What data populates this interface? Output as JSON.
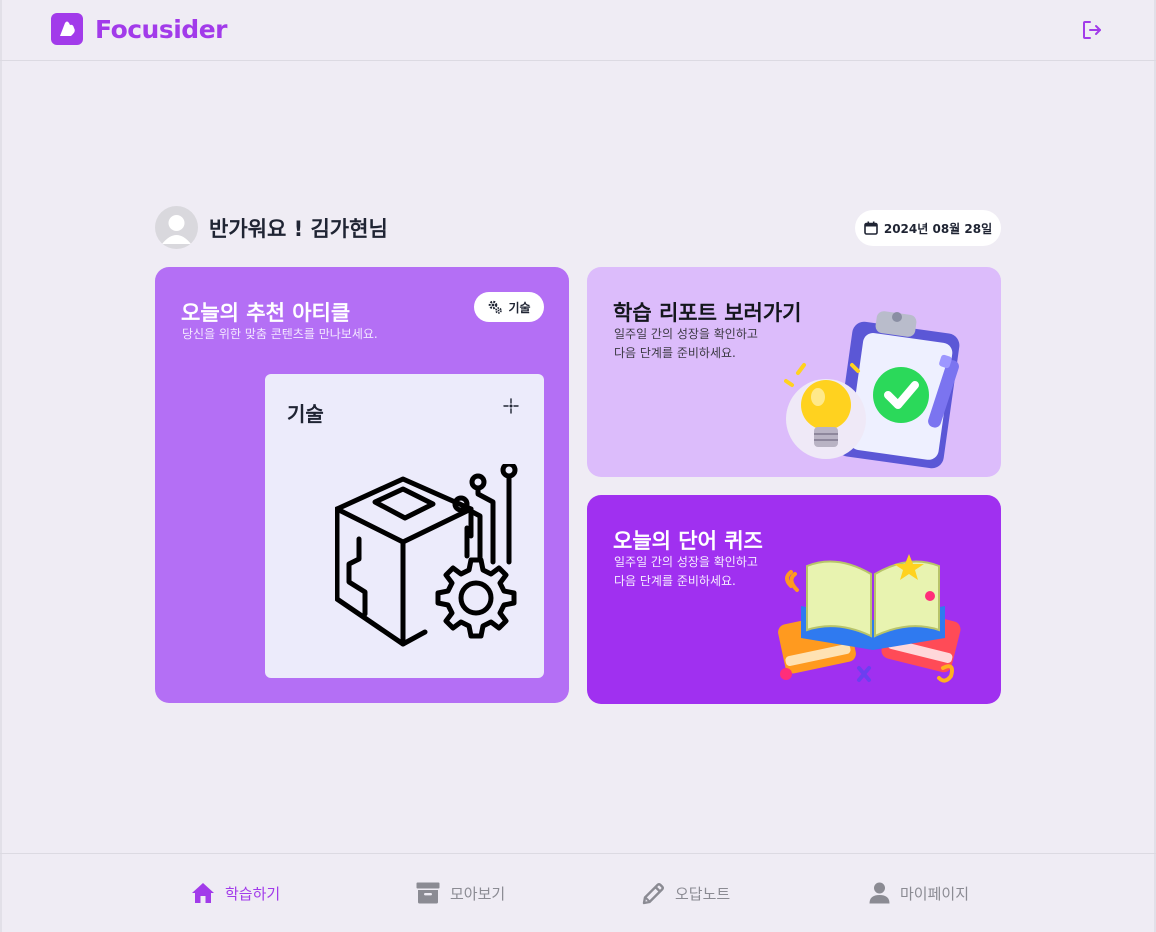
{
  "header": {
    "brand": "Focusider"
  },
  "greeting": {
    "text": "반가워요 ! 김가현님",
    "date": "2024년 08월 28일"
  },
  "article_card": {
    "title": "오늘의 추천 아티클",
    "subtitle": "당신을 위한 맞춤 콘텐츠를 만나보세요.",
    "tag": "기술",
    "inner_title": "기술"
  },
  "report_card": {
    "title": "학습 리포트 보러가기",
    "subtitle_line1": "일주일 간의 성장을 확인하고",
    "subtitle_line2": "다음 단계를 준비하세요."
  },
  "quiz_card": {
    "title": "오늘의 단어 퀴즈",
    "subtitle_line1": "일주일 간의 성장을 확인하고",
    "subtitle_line2": "다음 단계를 준비하세요."
  },
  "bottom_nav": {
    "items": [
      {
        "label": "학습하기",
        "icon": "home-icon"
      },
      {
        "label": "모아보기",
        "icon": "archive-icon"
      },
      {
        "label": "오답노트",
        "icon": "pencil-icon"
      },
      {
        "label": "마이페이지",
        "icon": "user-icon"
      }
    ],
    "active_index": 0
  },
  "colors": {
    "accent": "#a23bea",
    "background": "#efecf4",
    "article_card": "#b46ff5",
    "report_card": "#dcbcfb",
    "quiz_card": "#a030f0",
    "inactive_nav": "#8b8b93"
  }
}
